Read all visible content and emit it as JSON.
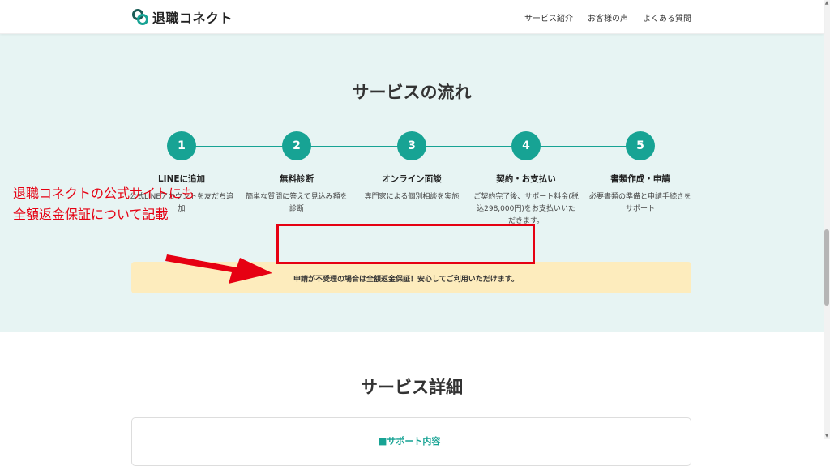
{
  "header": {
    "logo_text": "退職コネクト",
    "nav": [
      "サービス紹介",
      "お客様の声",
      "よくある質問"
    ]
  },
  "flow": {
    "title": "サービスの流れ",
    "steps": [
      {
        "num": "1",
        "title": "LINEに追加",
        "desc": "公式LINEアカウントを友だち追加"
      },
      {
        "num": "2",
        "title": "無料診断",
        "desc": "簡単な質問に答えて見込み額を診断"
      },
      {
        "num": "3",
        "title": "オンライン面談",
        "desc": "専門家による個別相談を実施"
      },
      {
        "num": "4",
        "title": "契約・お支払い",
        "desc": "ご契約完了後、サポート料金(税込298,000円)をお支払いいただきます。"
      },
      {
        "num": "5",
        "title": "書類作成・申請",
        "desc": "必要書類の準備と申請手続きをサポート"
      }
    ],
    "guarantee": "申請が不受理の場合は全額返金保証！安心してご利用いただけます。"
  },
  "annotation": {
    "line1": "退職コネクトの公式サイトにも",
    "line2": "全額返金保証について記載",
    "color": "#e60012"
  },
  "detail": {
    "title": "サービス詳細",
    "card_title": "■サポート内容"
  },
  "colors": {
    "accent": "#17a394",
    "section_bg": "#e7f4f3",
    "guarantee_bg": "#fdecbd",
    "annotation_red": "#e60012"
  }
}
